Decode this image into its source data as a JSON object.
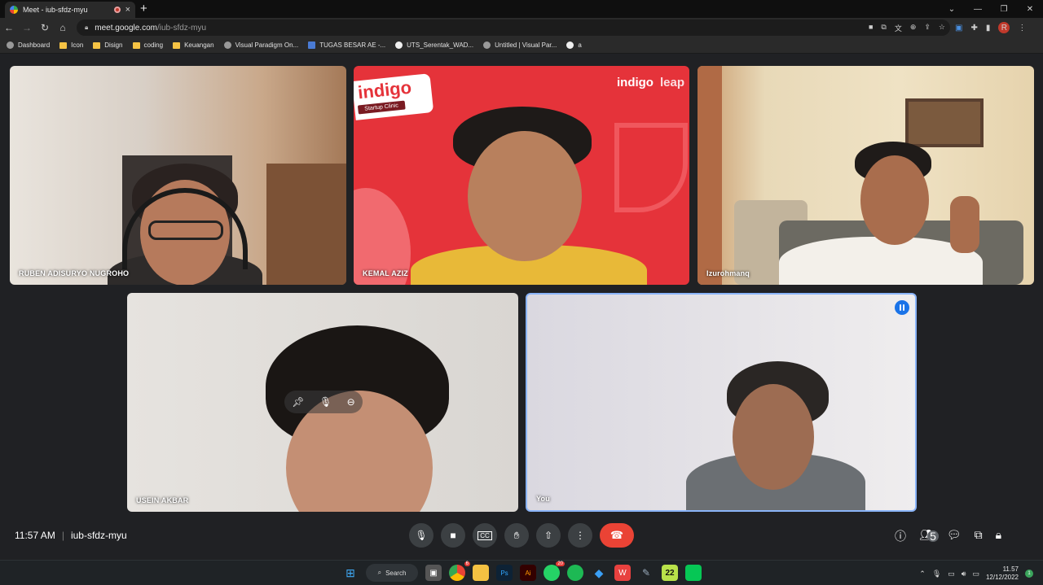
{
  "browser": {
    "tab_title": "Meet - iub-sfdz-myu",
    "tab_close": "×",
    "new_tab": "+",
    "url_host": "meet.google.com",
    "url_path": "/iub-sfdz-myu",
    "profile_initial": "R"
  },
  "bookmarks": [
    {
      "label": "Dashboard",
      "icon": "globe-icon"
    },
    {
      "label": "Icon",
      "icon": "folder-icon"
    },
    {
      "label": "Disign",
      "icon": "folder-icon"
    },
    {
      "label": "coding",
      "icon": "folder-icon"
    },
    {
      "label": "Keuangan",
      "icon": "folder-icon"
    },
    {
      "label": "Visual Paradigm On...",
      "icon": "visual-paradigm-icon"
    },
    {
      "label": "TUGAS BESAR AE -...",
      "icon": "doc-icon"
    },
    {
      "label": "UTS_Serentak_WAD...",
      "icon": "github-icon"
    },
    {
      "label": "Untitled | Visual Par...",
      "icon": "visual-paradigm-icon"
    },
    {
      "label": "a",
      "icon": "github-icon"
    }
  ],
  "participants": [
    {
      "name": "RUBEN ADISURYO NUGROHO"
    },
    {
      "name": "KEMAL AZIZ"
    },
    {
      "name": "Izurohmanq"
    },
    {
      "name": "USEIN AKBAR"
    },
    {
      "name": "You"
    }
  ],
  "kemal_background": {
    "brand": "indigo",
    "sub": "Startup Clinic",
    "right_brand": "indigo",
    "right_brand2": "leap"
  },
  "meeting": {
    "time": "11:57 AM",
    "separator": "|",
    "code": "iub-sfdz-myu",
    "participant_count": "5"
  },
  "taskbar": {
    "search_label": "Search",
    "chrome_badge": "6",
    "whatsapp_badge": "20",
    "app_22": "22",
    "clock_time": "11.57",
    "clock_date": "12/12/2022",
    "notification_count": "1"
  },
  "colors": {
    "end_call": "#ea4335",
    "speaking_indicator": "#1a73e8",
    "active_tile_border": "#8ab4f8",
    "kemal_bg": "#e5333a"
  }
}
